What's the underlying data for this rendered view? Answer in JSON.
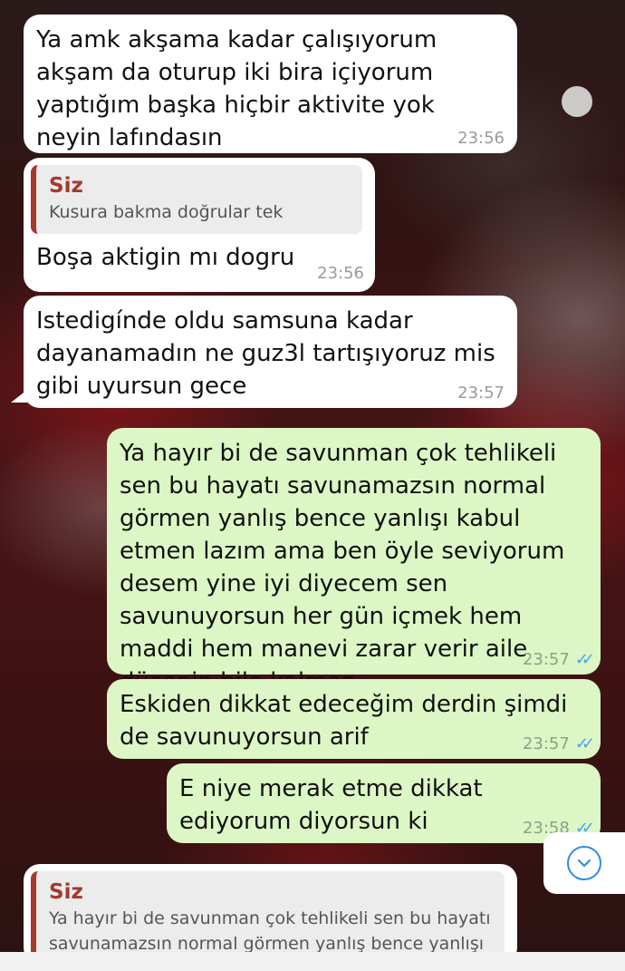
{
  "messages": [
    {
      "text": "Ya amk akşama kadar çalışıyorum akşam da oturup iki bira içiyorum yaptığım başka hiçbir aktivite yok neyin lafındasın",
      "time": "23:56"
    },
    {
      "quote_name": "Siz",
      "quote_text": "Kusura bakma doğrular tek",
      "text": "Boşa aktigin mı dogru",
      "time": "23:56"
    },
    {
      "text": "Istedigínde oldu samsuna kadar dayanamadın ne guz3l tartışıyoruz mis gibi uyursun gece",
      "time": "23:57"
    },
    {
      "text": "Ya hayır bi de savunman çok tehlikeli sen bu hayatı savunamazsın normal görmen yanlış bence yanlışı kabul etmen lazım ama ben öyle seviyorum desem yine iyi diyecem sen savunuyorsun her gün içmek hem maddi hem manevi zarar verir aile düzenin bile kalmaz",
      "time": "23:57"
    },
    {
      "text": "Eskiden dikkat edeceğim derdin şimdi de savunuyorsun arif",
      "time": "23:57"
    },
    {
      "text": "E niye merak etme dikkat ediyorum diyorsun ki",
      "time": "23:58"
    },
    {
      "quote_name": "Siz",
      "quote_text": "Ya hayır bi de savunman çok tehlikeli sen bu hayatı savunamazsın normal görmen yanlış bence yanlışı"
    }
  ],
  "icons": {
    "read_receipt": "double-check-icon",
    "scroll_down": "chevron-down-circle-icon"
  },
  "colors": {
    "incoming": "#ffffff",
    "outgoing": "#dcf7c5",
    "quote_accent": "#a6392c",
    "read_tick": "#4aa3f0",
    "scroll_icon": "#2f8be8"
  }
}
